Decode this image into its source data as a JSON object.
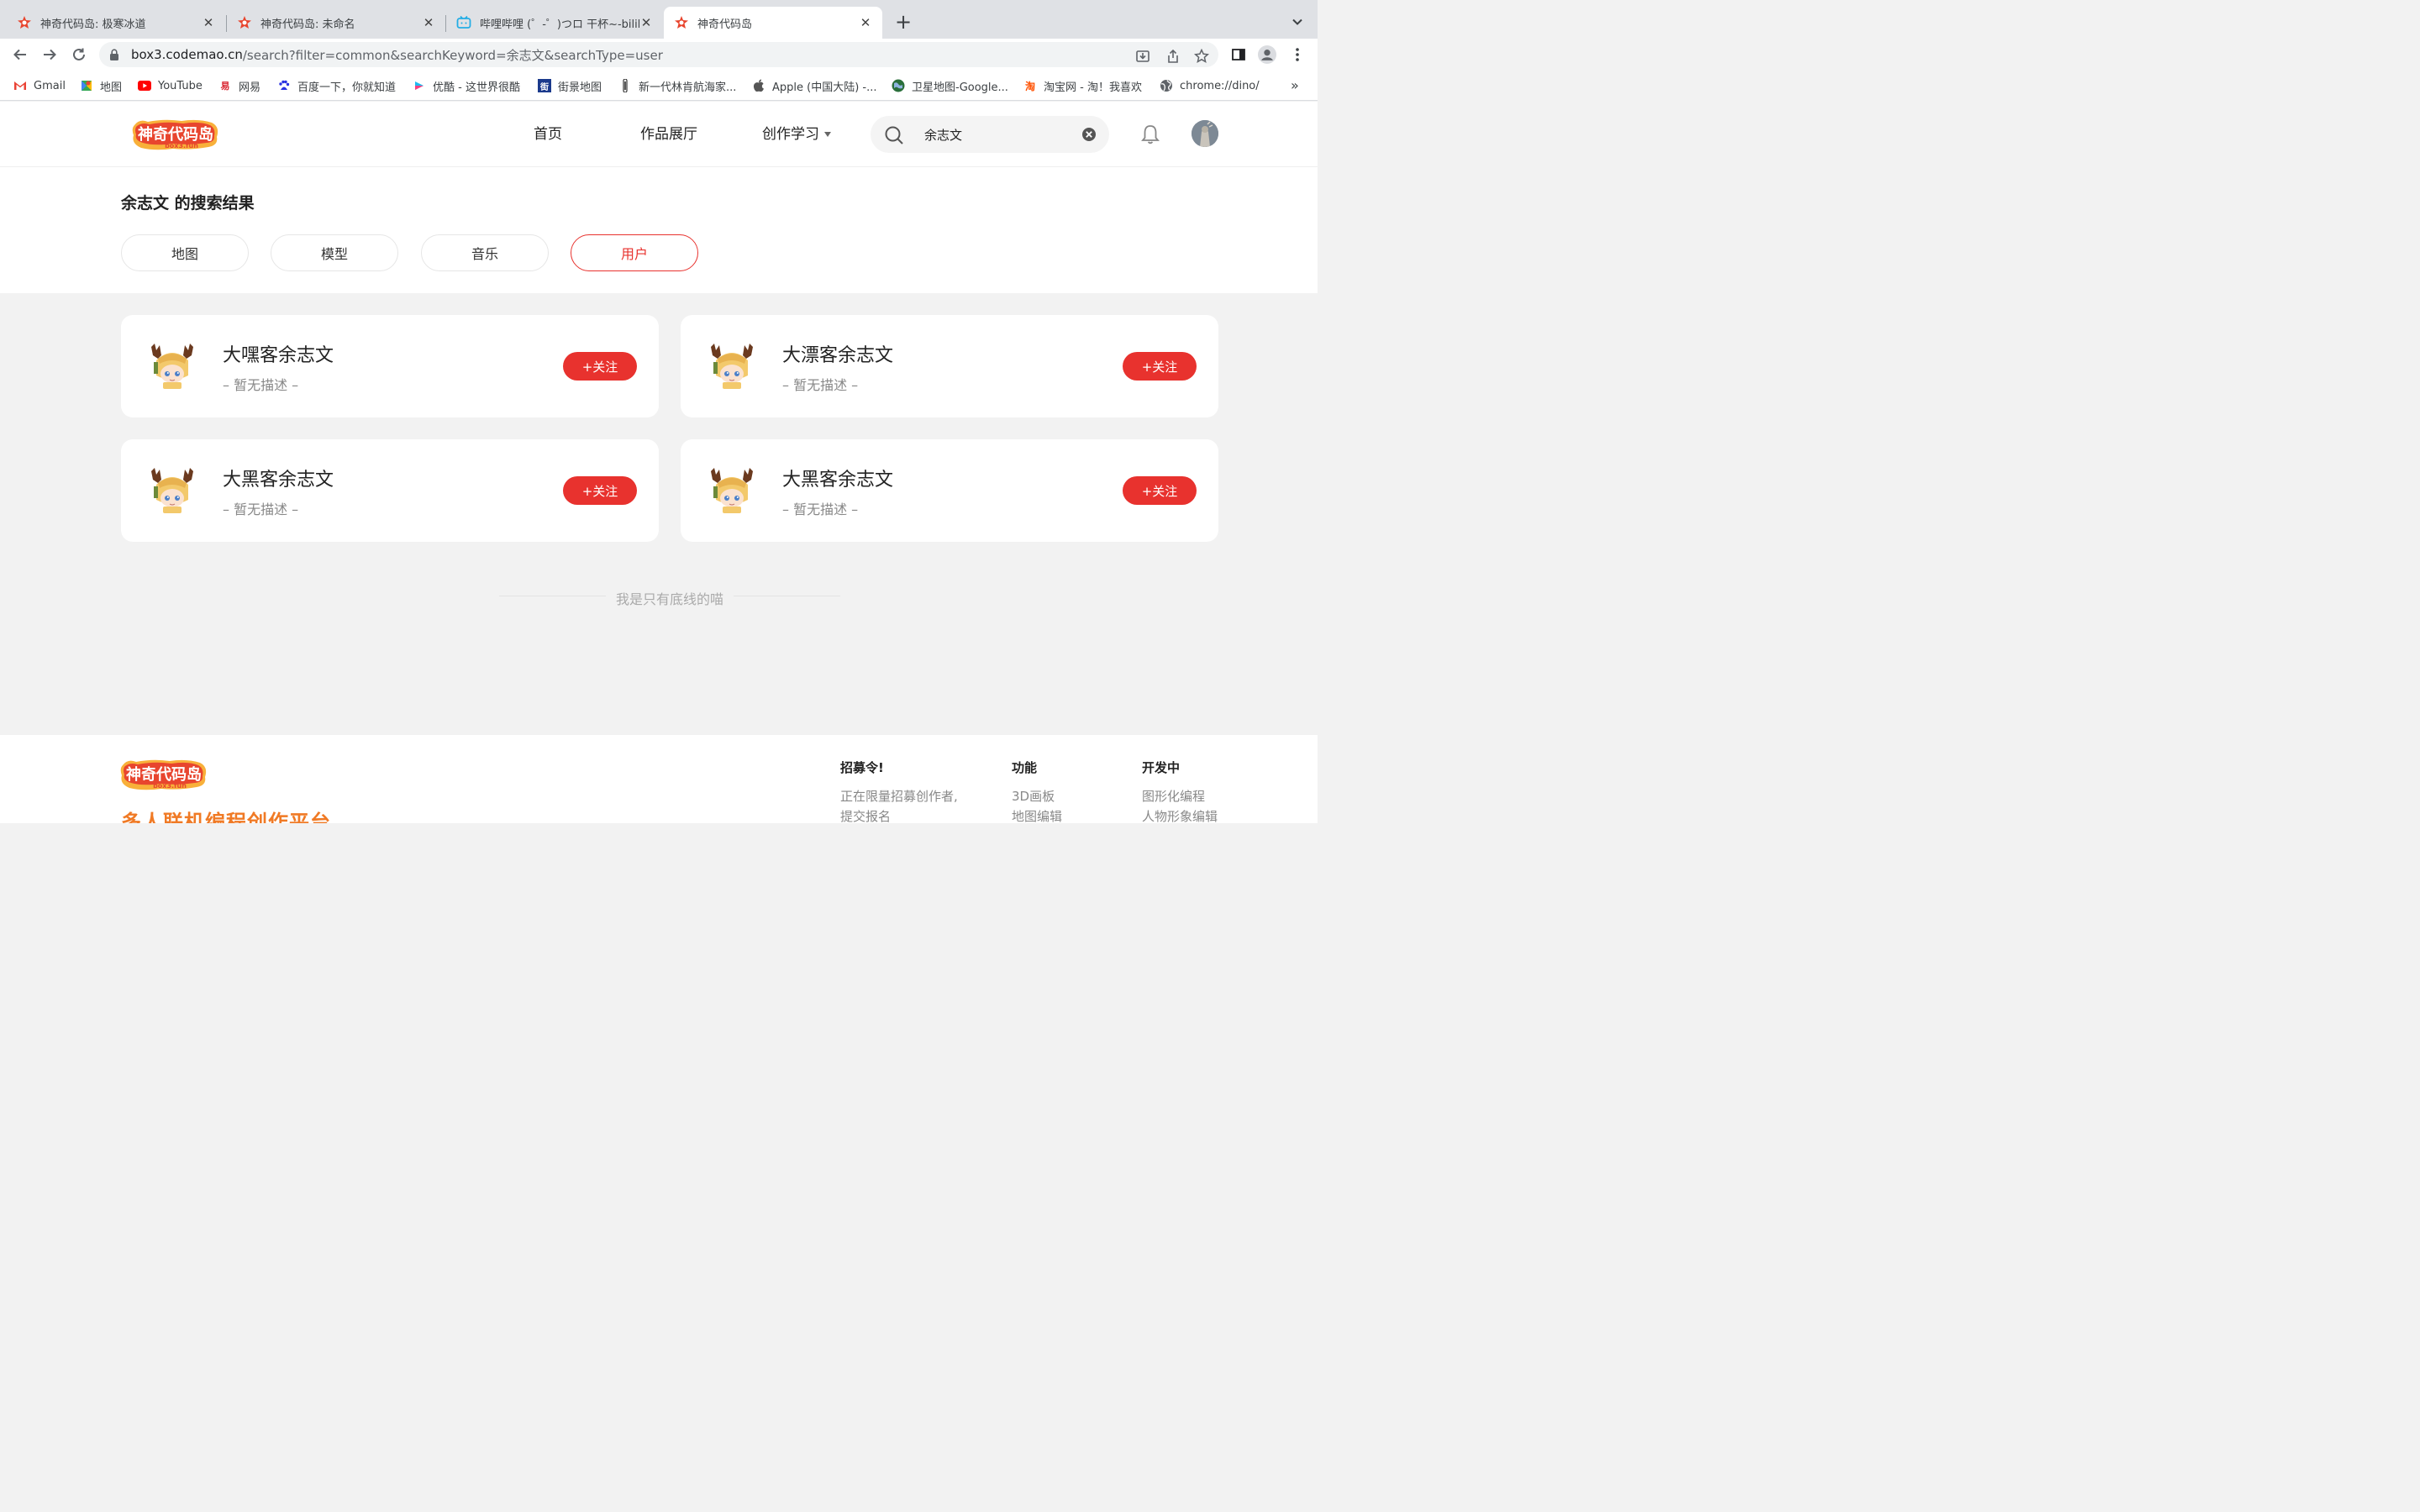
{
  "browser": {
    "tabs": [
      {
        "title": "神奇代码岛: 极寒冰道",
        "icon": "codemao-icon"
      },
      {
        "title": "神奇代码岛: 未命名",
        "icon": "codemao-icon"
      },
      {
        "title": "哔哩哔哩 (゜-゜)つロ 干杯~-bilibili",
        "icon": "bilibili-icon"
      },
      {
        "title": "神奇代码岛",
        "icon": "codemao-icon",
        "active": true
      }
    ],
    "url_host": "box3.codemao.cn",
    "url_rest": "/search?filter=common&searchKeyword=余志文&searchType=user",
    "bookmarks": [
      {
        "label": "Gmail",
        "icon": "gmail-icon"
      },
      {
        "label": "地图",
        "icon": "maps-icon"
      },
      {
        "label": "YouTube",
        "icon": "youtube-icon"
      },
      {
        "label": "网易",
        "icon": "netease-icon"
      },
      {
        "label": "百度一下，你就知道",
        "icon": "baidu-icon"
      },
      {
        "label": "优酷 - 这世界很酷",
        "icon": "youku-icon"
      },
      {
        "label": "街景地图",
        "icon": "streetview-icon"
      },
      {
        "label": "新一代林肯航海家...",
        "icon": "lincoln-icon"
      },
      {
        "label": "Apple (中国大陆) -...",
        "icon": "apple-icon"
      },
      {
        "label": "卫星地图-Google...",
        "icon": "earth-icon"
      },
      {
        "label": "淘宝网 - 淘！我喜欢",
        "icon": "taobao-icon"
      },
      {
        "label": "chrome://dino/",
        "icon": "globe-icon"
      }
    ],
    "bookmarks_more": "»"
  },
  "site": {
    "nav": {
      "home": "首页",
      "gallery": "作品展厅",
      "learn": "创作学习"
    },
    "search_value": "余志文",
    "result_title": "余志文 的搜索结果",
    "filters": [
      "地图",
      "模型",
      "音乐",
      "用户"
    ],
    "active_filter": "用户",
    "results": [
      {
        "name": "大嘿客余志文",
        "desc": "– 暂无描述 –",
        "follow": "+关注"
      },
      {
        "name": "大漂客余志文",
        "desc": "– 暂无描述 –",
        "follow": "+关注"
      },
      {
        "name": "大黑客余志文",
        "desc": "– 暂无描述 –",
        "follow": "+关注"
      },
      {
        "name": "大黑客余志文",
        "desc": "– 暂无描述 –",
        "follow": "+关注"
      }
    ],
    "end_text": "我是只有底线的喵",
    "logo_text": "神奇代码岛",
    "logo_sub": "box3.fun"
  },
  "footer": {
    "slogan": "多人联机编程创作平台",
    "columns": [
      {
        "title": "招募令!",
        "links": [
          "正在限量招募创作者,",
          "提交报名"
        ]
      },
      {
        "title": "功能",
        "links": [
          "3D画板",
          "地图编辑"
        ]
      },
      {
        "title": "开发中",
        "links": [
          "图形化编程",
          "人物形象编辑"
        ]
      }
    ]
  },
  "colors": {
    "accent": "#e8322e",
    "slogan": "#f07a25",
    "page_bg": "#f2f2f2"
  }
}
